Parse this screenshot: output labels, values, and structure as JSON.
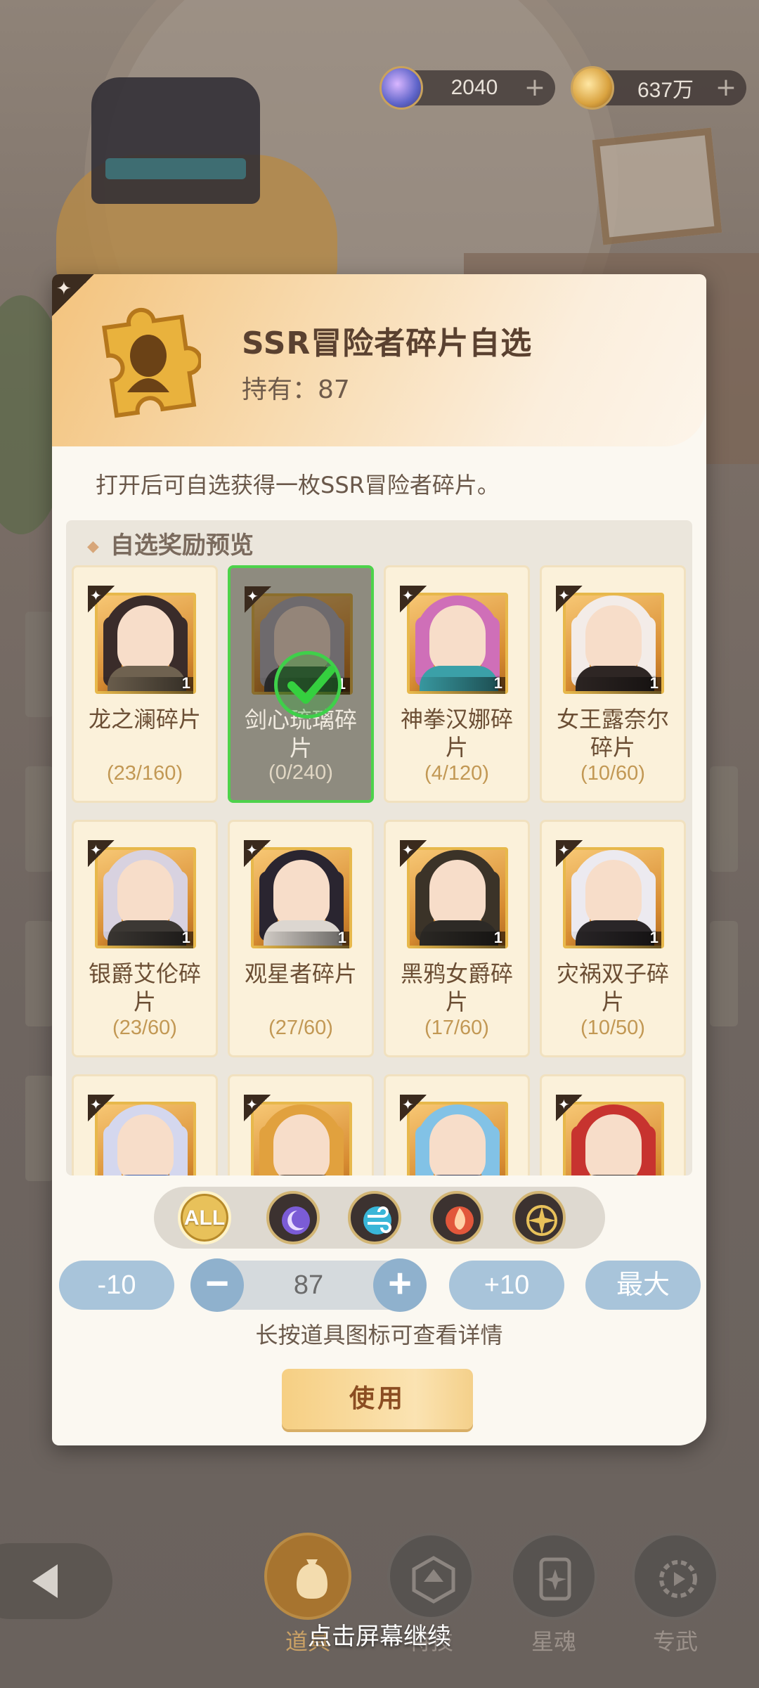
{
  "currencies": [
    {
      "icon": "gem-orb-icon",
      "value": "2040",
      "plus": "+"
    },
    {
      "icon": "gold-coin-icon",
      "value": "637万",
      "plus": "+"
    }
  ],
  "modal": {
    "title": "SSR冒险者碎片自选",
    "owned_label": "持有：",
    "owned_value": "87",
    "description": "打开后可自选获得一枚SSR冒险者碎片。",
    "preview_title": "自选奖励预览",
    "items": [
      {
        "name": "龙之澜碎片",
        "progress": "(23/160)",
        "qty": "1",
        "selected": false,
        "hair": "#3a2c2a",
        "body": "#6f6250"
      },
      {
        "name": "剑心琉璃碎片",
        "progress": "(0/240)",
        "qty": "1",
        "selected": true,
        "hair": "#b8b1b5",
        "body": "#4a4a4a"
      },
      {
        "name": "神拳汉娜碎片",
        "progress": "(4/120)",
        "qty": "1",
        "selected": false,
        "hair": "#cf6fb8",
        "body": "#3ba0a8"
      },
      {
        "name": "女王露奈尔碎片",
        "progress": "(10/60)",
        "qty": "1",
        "selected": false,
        "hair": "#f3ece8",
        "body": "#2e2624"
      },
      {
        "name": "银爵艾伦碎片",
        "progress": "(23/60)",
        "qty": "1",
        "selected": false,
        "hair": "#d8d2e0",
        "body": "#3c3834"
      },
      {
        "name": "观星者碎片",
        "progress": "(27/60)",
        "qty": "1",
        "selected": false,
        "hair": "#2a2530",
        "body": "#dcd6d0"
      },
      {
        "name": "黑鸦女爵碎片",
        "progress": "(17/60)",
        "qty": "1",
        "selected": false,
        "hair": "#3b3328",
        "body": "#2d2a26"
      },
      {
        "name": "灾祸双子碎片",
        "progress": "(10/50)",
        "qty": "1",
        "selected": false,
        "hair": "#eceaf0",
        "body": "#2a2628"
      },
      {
        "name": "",
        "progress": "",
        "qty": "",
        "selected": false,
        "hair": "#d4d7ee",
        "body": "#3f5da8"
      },
      {
        "name": "",
        "progress": "",
        "qty": "",
        "selected": false,
        "hair": "#e1a13e",
        "body": "#4a3a2c"
      },
      {
        "name": "",
        "progress": "",
        "qty": "",
        "selected": false,
        "hair": "#82c2e6",
        "body": "#3a3e56"
      },
      {
        "name": "",
        "progress": "",
        "qty": "",
        "selected": false,
        "hair": "#c7332f",
        "body": "#3a3230"
      }
    ],
    "filters": [
      {
        "id": "all",
        "label": "ALL",
        "icon": "all-filter-icon"
      },
      {
        "id": "dark",
        "icon": "dark-element-icon",
        "color": "#7b5cd6"
      },
      {
        "id": "wind",
        "icon": "wind-element-icon",
        "color": "#39b6d8"
      },
      {
        "id": "fire",
        "icon": "fire-element-icon",
        "color": "#e2573b"
      },
      {
        "id": "light",
        "icon": "light-element-icon",
        "color": "#e8c15a"
      }
    ],
    "controls": {
      "minus10": "-10",
      "quantity": "87",
      "plus10": "+10",
      "max": "最大"
    },
    "hint": "长按道具图标可查看详情",
    "use_label": "使用"
  },
  "nav": [
    {
      "label": "道具",
      "icon": "bag-icon",
      "active": true
    },
    {
      "label": "特技",
      "icon": "dice-icon",
      "active": false
    },
    {
      "label": "星魂",
      "icon": "card-star-icon",
      "active": false
    },
    {
      "label": "专武",
      "icon": "weapon-gear-icon",
      "active": false
    }
  ],
  "continue_tip": "点击屏幕继续"
}
